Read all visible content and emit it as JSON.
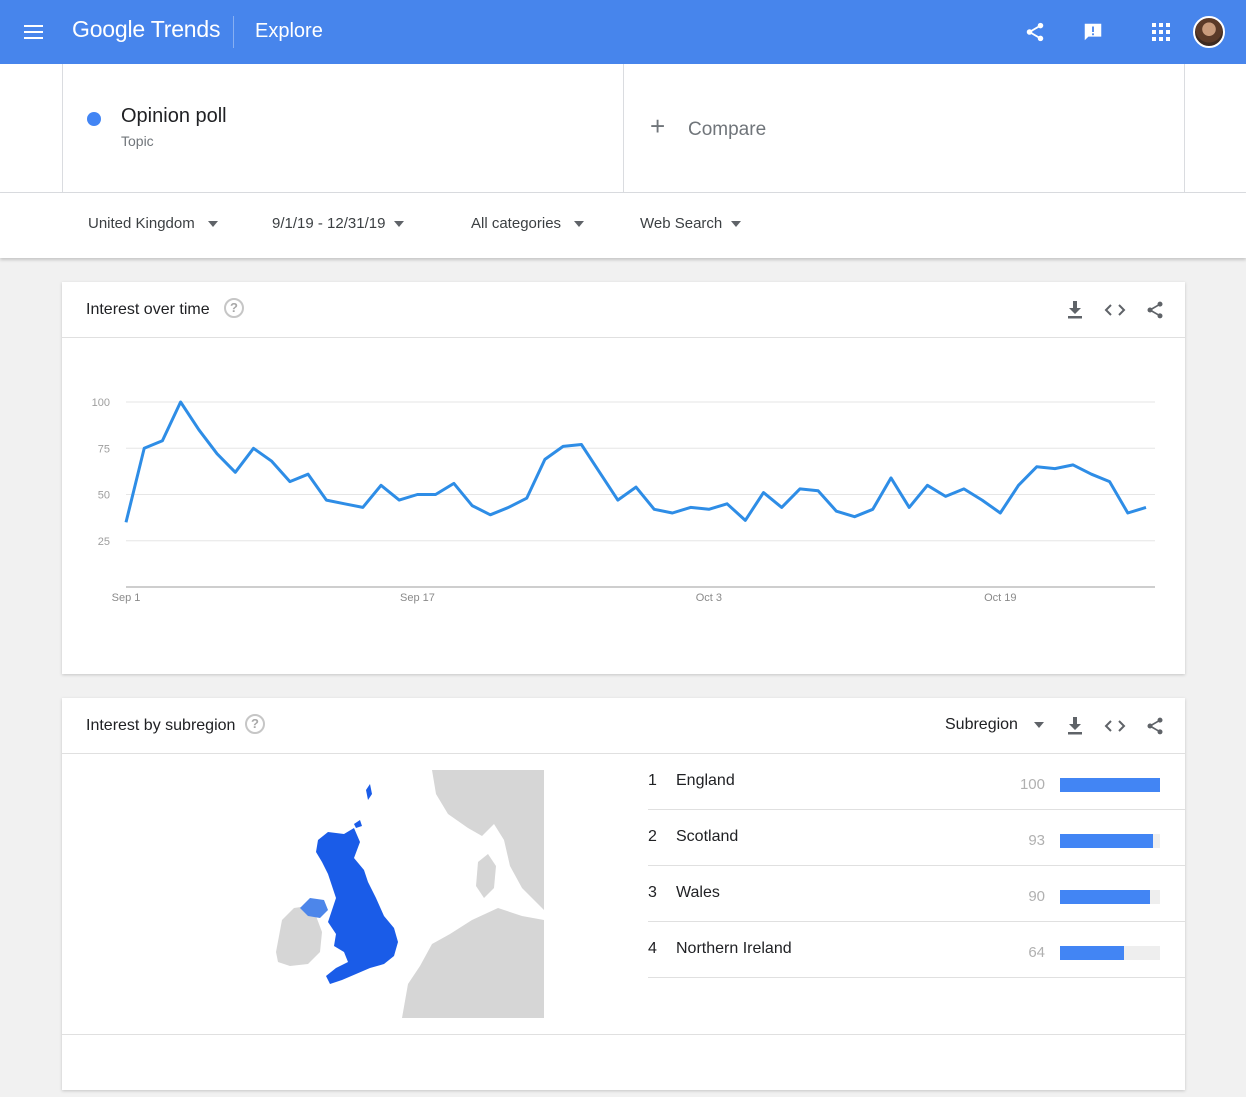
{
  "topbar": {
    "logo_google": "Google",
    "logo_trends": "Trends",
    "section": "Explore",
    "icons": [
      "menu-icon",
      "share-icon",
      "feedback-icon",
      "apps-icon",
      "avatar"
    ]
  },
  "terms": {
    "term1_name": "Opinion poll",
    "term1_type": "Topic",
    "term1_color": "#4285f4",
    "compare_plus": "+",
    "compare_label": "Compare"
  },
  "filters": {
    "region": "United Kingdom",
    "date_range": "9/1/19 - 12/31/19",
    "category": "All categories",
    "search_type": "Web Search"
  },
  "interest_over_time": {
    "title": "Interest over time",
    "help": "?"
  },
  "chart_data": {
    "type": "line",
    "color": "#2e8de6",
    "y_ticks": [
      "100",
      "75",
      "50",
      "25"
    ],
    "x_ticks": [
      "Sep 1",
      "Sep 17",
      "Oct 3",
      "Oct 19"
    ],
    "ylim": [
      0,
      100
    ],
    "grid": true,
    "values": [
      35,
      75,
      79,
      100,
      85,
      72,
      62,
      75,
      68,
      57,
      61,
      47,
      45,
      43,
      55,
      47,
      50,
      50,
      56,
      44,
      39,
      43,
      48,
      69,
      76,
      77,
      62,
      47,
      54,
      42,
      40,
      43,
      42,
      45,
      36,
      51,
      43,
      53,
      52,
      41,
      38,
      42,
      59,
      43,
      55,
      49,
      53,
      47,
      40,
      55,
      65,
      64,
      66,
      61,
      57,
      40,
      43
    ]
  },
  "interest_by_subregion": {
    "title": "Interest by subregion",
    "help": "?",
    "selector": "Subregion",
    "rows": [
      {
        "rank": "1",
        "name": "England",
        "value": "100",
        "score": 100
      },
      {
        "rank": "2",
        "name": "Scotland",
        "value": "93",
        "score": 93
      },
      {
        "rank": "3",
        "name": "Wales",
        "value": "90",
        "score": 90
      },
      {
        "rank": "4",
        "name": "Northern Ireland",
        "value": "64",
        "score": 64
      }
    ],
    "map_colors": {
      "uk": "#1a5ce8",
      "ni": "#4d86ea",
      "other": "#d6d6d6",
      "sea": "#ffffff"
    }
  }
}
